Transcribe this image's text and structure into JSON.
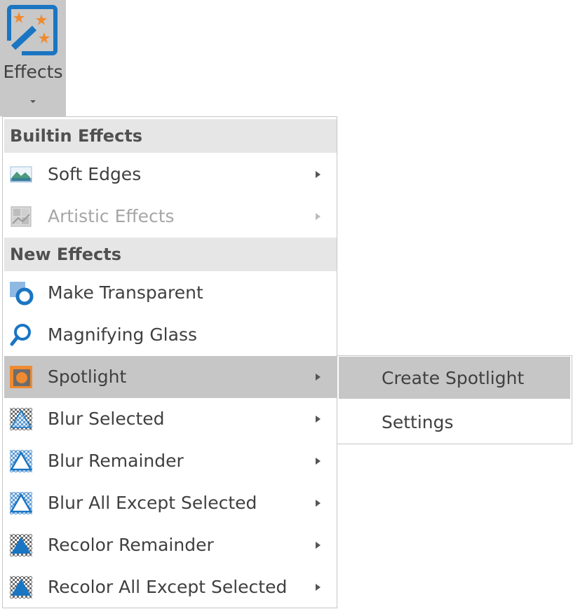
{
  "ribbon": {
    "label": "Effects",
    "icon": "magic-wand-stars-icon"
  },
  "menu": {
    "sections": [
      {
        "header": "Builtin Effects"
      },
      {
        "header": "New Effects"
      }
    ],
    "items": [
      {
        "label": "Soft Edges",
        "icon": "soft-edges-icon",
        "submenu": true,
        "enabled": true
      },
      {
        "label": "Artistic Effects",
        "icon": "artistic-effects-icon",
        "submenu": true,
        "enabled": false
      },
      {
        "label": "Make Transparent",
        "icon": "make-transparent-icon",
        "submenu": false,
        "enabled": true
      },
      {
        "label": "Magnifying Glass",
        "icon": "magnifying-glass-icon",
        "submenu": false,
        "enabled": true
      },
      {
        "label": "Spotlight",
        "icon": "spotlight-icon",
        "submenu": true,
        "enabled": true,
        "highlighted": true
      },
      {
        "label": "Blur Selected",
        "icon": "blur-selected-icon",
        "submenu": true,
        "enabled": true
      },
      {
        "label": "Blur Remainder",
        "icon": "blur-remainder-icon",
        "submenu": true,
        "enabled": true
      },
      {
        "label": "Blur All Except Selected",
        "icon": "blur-all-except-icon",
        "submenu": true,
        "enabled": true
      },
      {
        "label": "Recolor Remainder",
        "icon": "recolor-remainder-icon",
        "submenu": true,
        "enabled": true
      },
      {
        "label": "Recolor All Except Selected",
        "icon": "recolor-all-except-icon",
        "submenu": true,
        "enabled": true
      }
    ]
  },
  "submenu": {
    "items": [
      {
        "label": "Create Spotlight",
        "highlighted": true
      },
      {
        "label": "Settings"
      }
    ]
  },
  "colors": {
    "accent_blue": "#1a75c2",
    "accent_orange": "#f08a30",
    "highlight": "#c6c6c6",
    "header_bg": "#e6e6e6"
  }
}
